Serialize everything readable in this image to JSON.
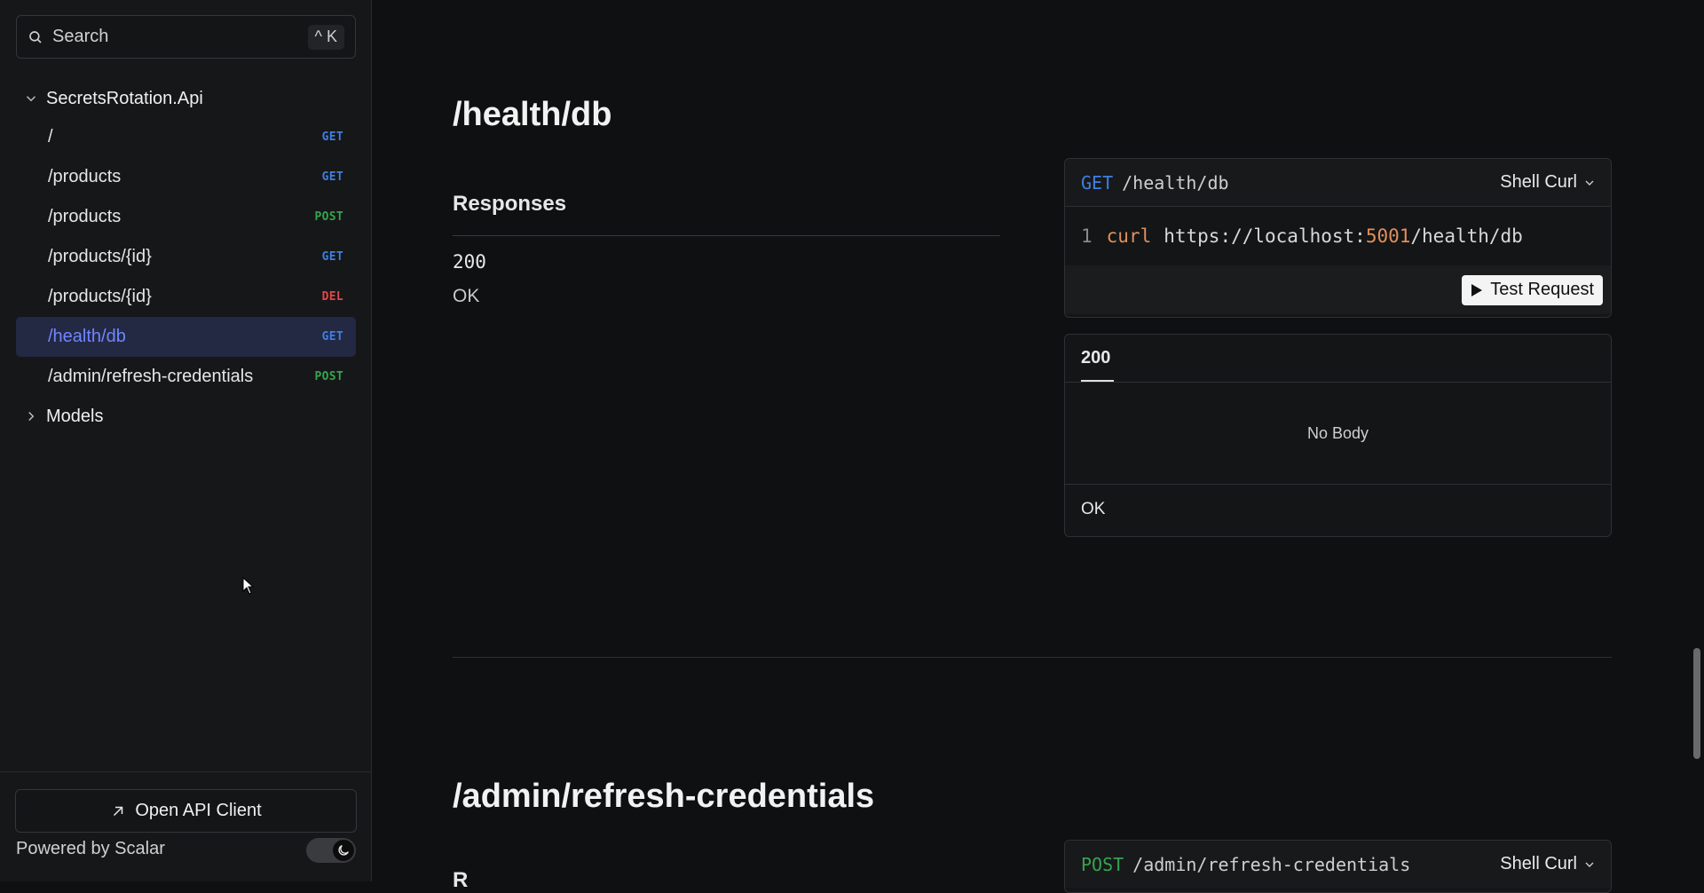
{
  "sidebar": {
    "search": {
      "placeholder": "Search",
      "shortcut": "^ K"
    },
    "group": {
      "title": "SecretsRotation.Api"
    },
    "items": [
      {
        "label": "/",
        "method": "GET"
      },
      {
        "label": "/products",
        "method": "GET"
      },
      {
        "label": "/products",
        "method": "POST"
      },
      {
        "label": "/products/{id}",
        "method": "GET"
      },
      {
        "label": "/products/{id}",
        "method": "DEL"
      },
      {
        "label": "/health/db",
        "method": "GET",
        "active": true
      },
      {
        "label": "/admin/refresh-credentials",
        "method": "POST"
      }
    ],
    "models": {
      "label": "Models"
    },
    "footer": {
      "open_client": "Open API Client",
      "powered": "Powered by Scalar"
    }
  },
  "main": {
    "section1": {
      "title": "/health/db",
      "responses_title": "Responses",
      "response_code": "200",
      "response_text": "OK",
      "request_card": {
        "method": "GET",
        "path": "/health/db",
        "lang": "Shell Curl",
        "line_no": "1",
        "cmd": "curl",
        "url_pre": "https://localhost:",
        "port": "5001",
        "url_post": "/health/db",
        "button": "Test Request"
      },
      "response_card": {
        "tab": "200",
        "body": "No Body",
        "footer": "OK"
      }
    },
    "section2": {
      "title": "/admin/refresh-credentials",
      "responses_title_partial": "R",
      "request_card": {
        "method": "POST",
        "path": "/admin/refresh-credentials",
        "lang": "Shell Curl"
      }
    }
  },
  "colors": {
    "get": "#3f7fe2",
    "post": "#35a44f",
    "delete": "#e54545",
    "active_bg": "#232843",
    "active_text": "#6f86ff"
  }
}
